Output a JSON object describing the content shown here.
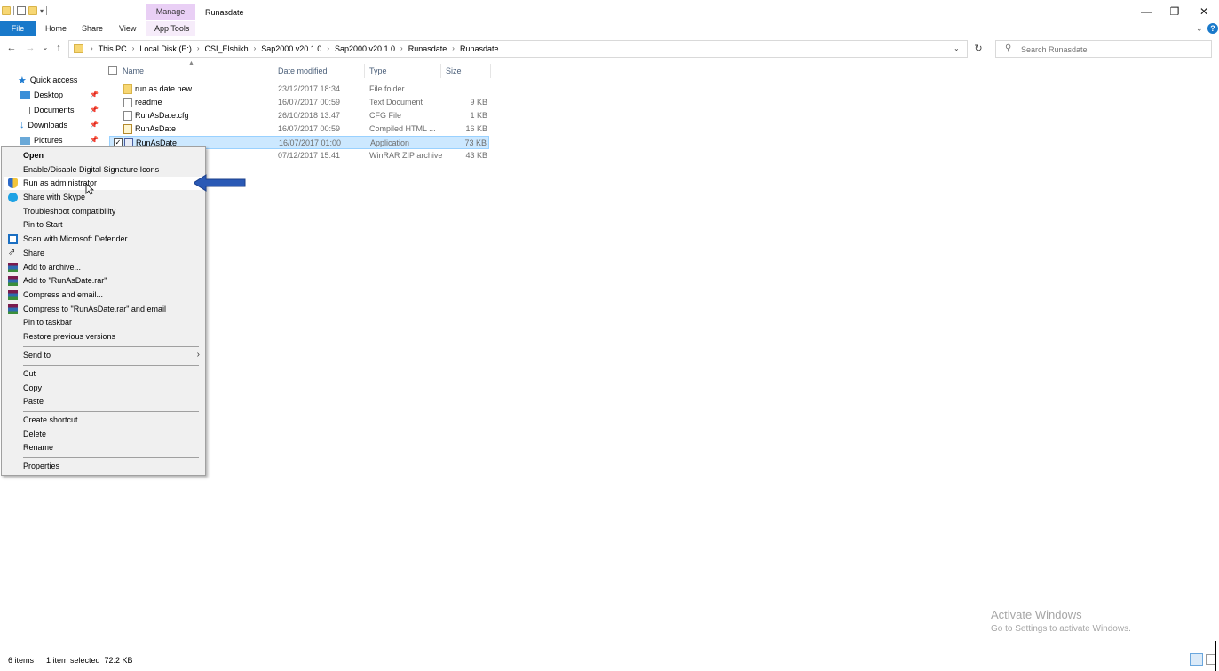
{
  "window": {
    "title": "Runasdate",
    "manage_tab": "Manage",
    "controls": {
      "minimize": "—",
      "restore": "❐",
      "close": "✕"
    }
  },
  "ribbon": {
    "file": "File",
    "tabs": [
      "Home",
      "Share",
      "View",
      "App Tools"
    ],
    "help": "?"
  },
  "address": {
    "breadcrumbs": [
      "This PC",
      "Local Disk (E:)",
      "CSI_Elshikh",
      "Sap2000.v20.1.0",
      "Sap2000.v20.1.0",
      "Runasdate",
      "Runasdate"
    ]
  },
  "search": {
    "placeholder": "Search Runasdate"
  },
  "nav_pane": {
    "items": [
      {
        "label": "Quick access",
        "icon": "star-icon"
      },
      {
        "label": "Desktop",
        "icon": "desktop-icon",
        "pinned": true
      },
      {
        "label": "Documents",
        "icon": "documents-icon",
        "pinned": true
      },
      {
        "label": "Downloads",
        "icon": "downloads-icon",
        "pinned": true
      },
      {
        "label": "Pictures",
        "icon": "pictures-icon",
        "pinned": true
      }
    ]
  },
  "columns": {
    "name": "Name",
    "date": "Date modified",
    "type": "Type",
    "size": "Size"
  },
  "files": [
    {
      "name": "run as date new",
      "date": "23/12/2017 18:34",
      "type": "File folder",
      "size": "",
      "icon": "folder-icon"
    },
    {
      "name": "readme",
      "date": "16/07/2017 00:59",
      "type": "Text Document",
      "size": "9 KB",
      "icon": "text-document-icon"
    },
    {
      "name": "RunAsDate.cfg",
      "date": "26/10/2018 13:47",
      "type": "CFG File",
      "size": "1 KB",
      "icon": "cfg-file-icon"
    },
    {
      "name": "RunAsDate",
      "date": "16/07/2017 00:59",
      "type": "Compiled HTML ...",
      "size": "16 KB",
      "icon": "chm-help-icon"
    },
    {
      "name": "RunAsDate",
      "date": "16/07/2017 01:00",
      "type": "Application",
      "size": "73 KB",
      "icon": "application-icon",
      "selected": true
    },
    {
      "name": "",
      "date": "07/12/2017 15:41",
      "type": "WinRAR ZIP archive",
      "size": "43 KB",
      "icon": "zip-archive-icon"
    }
  ],
  "context_menu": {
    "items": [
      "Open",
      "Enable/Disable Digital Signature Icons",
      "Run as administrator",
      "Share with Skype",
      "Troubleshoot compatibility",
      "Pin to Start",
      "Scan with Microsoft Defender...",
      "Share",
      "Add to archive...",
      "Add to \"RunAsDate.rar\"",
      "Compress and email...",
      "Compress to \"RunAsDate.rar\" and email",
      "Pin to taskbar",
      "Restore previous versions",
      "Send to",
      "Cut",
      "Copy",
      "Paste",
      "Create shortcut",
      "Delete",
      "Rename",
      "Properties"
    ],
    "hovered": "Run as administrator"
  },
  "watermark": {
    "title": "Activate Windows",
    "subtitle": "Go to Settings to activate Windows."
  },
  "status": {
    "items": "6 items",
    "selected": "1 item selected  72.2 KB"
  },
  "colors": {
    "accent": "#1979ca",
    "selection": "#cce8ff",
    "manage_tab": "#e9cff5",
    "annotation_arrow": "#2a59b5"
  }
}
